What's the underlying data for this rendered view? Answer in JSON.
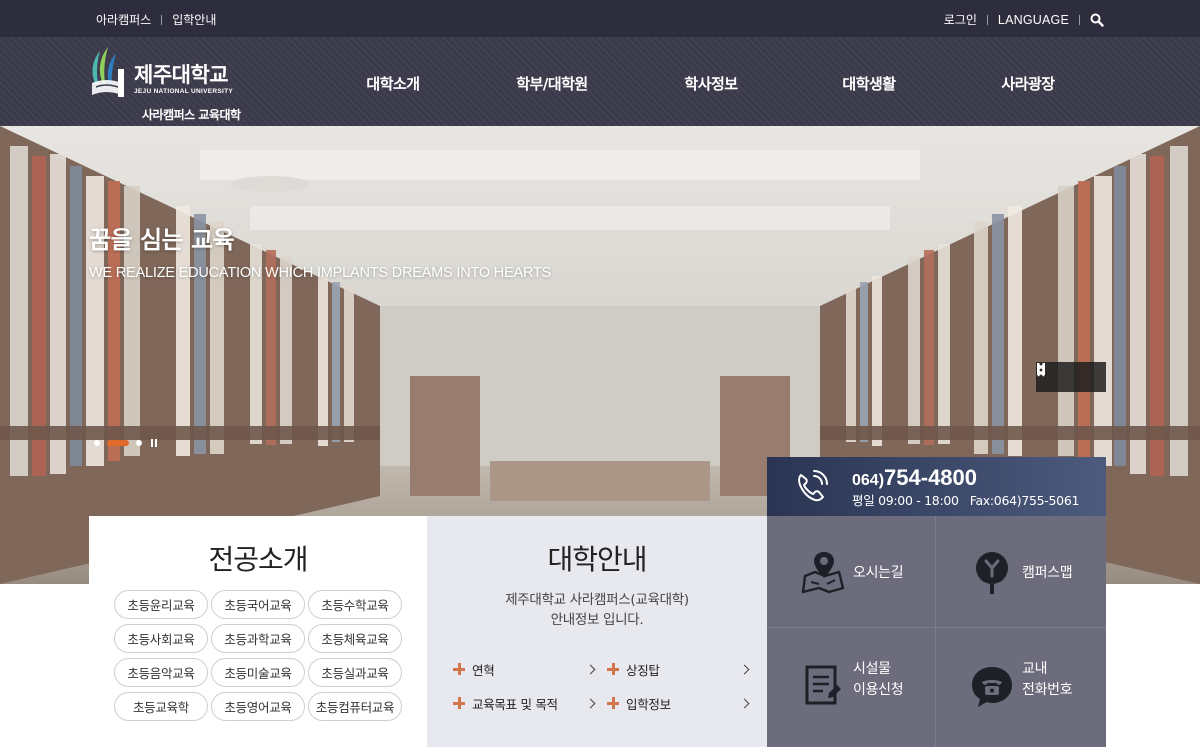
{
  "topbar": {
    "left_links": [
      "아라캠퍼스",
      "입학안내"
    ],
    "login": "로그인",
    "language": "LANGUAGE"
  },
  "header": {
    "logo_name_ko": "제주대학교",
    "logo_name_en": "JEJU NATIONAL UNIVERSITY",
    "logo_campus": "사라캠퍼스 교육대학",
    "nav": [
      "대학소개",
      "학부/대학원",
      "학사정보",
      "대학생활",
      "사라광장"
    ]
  },
  "hero": {
    "title": "꿈을 심는 교육",
    "subtitle": "WE REALIZE EDUCATION WHICH IMPLANTS DREAMS INTO HEARTS",
    "slide_count": 3,
    "active_slide": 2
  },
  "phone": {
    "area_code": "064)",
    "number": "754-4800",
    "hours": "평일 09:00 - 18:00   Fax:064)755-5061"
  },
  "major": {
    "title": "전공소개",
    "items": [
      "초등윤리교육",
      "초등국어교육",
      "초등수학교육",
      "초등사회교육",
      "초등과학교육",
      "초등체육교육",
      "초등음악교육",
      "초등미술교육",
      "초등실과교육",
      "초등교육학",
      "초등영어교육",
      "초등컴퓨터교육"
    ]
  },
  "guide": {
    "title": "대학안내",
    "desc_line1": "제주대학교 사라캠퍼스(교육대학)",
    "desc_line2": "안내정보 입니다.",
    "links": [
      "연혁",
      "상징탑",
      "교육목표 및 목적",
      "입학정보"
    ]
  },
  "quick": {
    "directions": "오시는길",
    "campus_map": "캠퍼스맵",
    "facility_line1": "시설물",
    "facility_line2": "이용신청",
    "phonebook_line1": "교내",
    "phonebook_line2": "전화번호"
  },
  "colors": {
    "topbar": "#2e2d3d",
    "header": "#3b3a4b",
    "accent": "#e06a2a",
    "plus": "#d2764a",
    "quick_bg": "#6c6c7c",
    "guide_bg": "#e8e8ef"
  }
}
